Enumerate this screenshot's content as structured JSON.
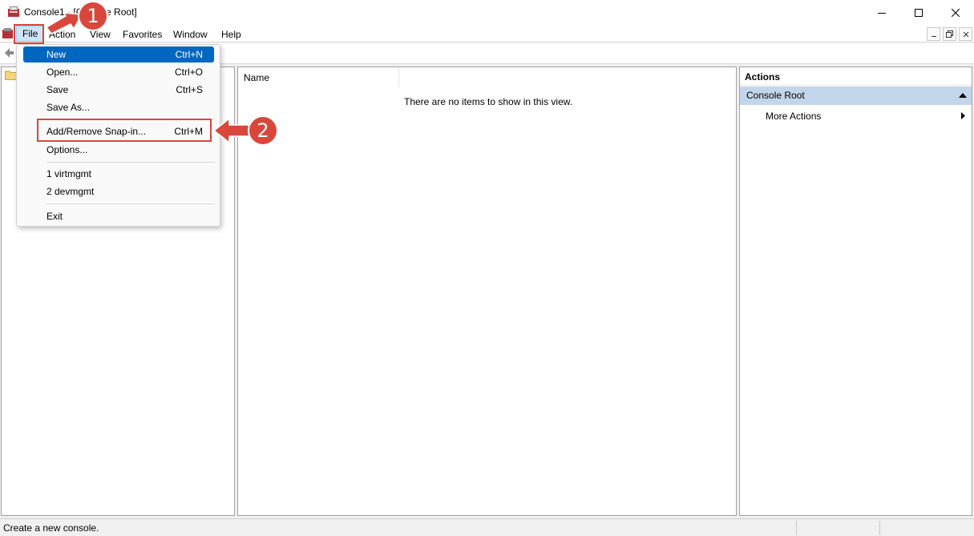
{
  "window": {
    "title": "Console1 - [Console Root]"
  },
  "menubar": {
    "items": [
      "File",
      "Action",
      "View",
      "Favorites",
      "Window",
      "Help"
    ]
  },
  "file_menu": {
    "items": [
      {
        "label": "New",
        "shortcut": "Ctrl+N",
        "highlighted": true
      },
      {
        "label": "Open...",
        "shortcut": "Ctrl+O"
      },
      {
        "label": "Save",
        "shortcut": "Ctrl+S"
      },
      {
        "label": "Save As...",
        "shortcut": ""
      },
      {
        "label": "Add/Remove Snap-in...",
        "shortcut": "Ctrl+M"
      },
      {
        "label": "Options...",
        "shortcut": ""
      },
      {
        "label": "1 virtmgmt",
        "shortcut": ""
      },
      {
        "label": "2 devmgmt",
        "shortcut": ""
      },
      {
        "label": "Exit",
        "shortcut": ""
      }
    ]
  },
  "content": {
    "column_name": "Name",
    "empty_message": "There are no items to show in this view."
  },
  "actions": {
    "header": "Actions",
    "root": "Console Root",
    "more": "More Actions"
  },
  "statusbar": {
    "text": "Create a new console."
  },
  "annotations": {
    "step1": "1",
    "step2": "2",
    "color": "#d9473c"
  },
  "colors": {
    "menu_highlight": "#0067c0",
    "actions_selected": "#c3d5ea",
    "file_hover": "#cce4f7"
  }
}
